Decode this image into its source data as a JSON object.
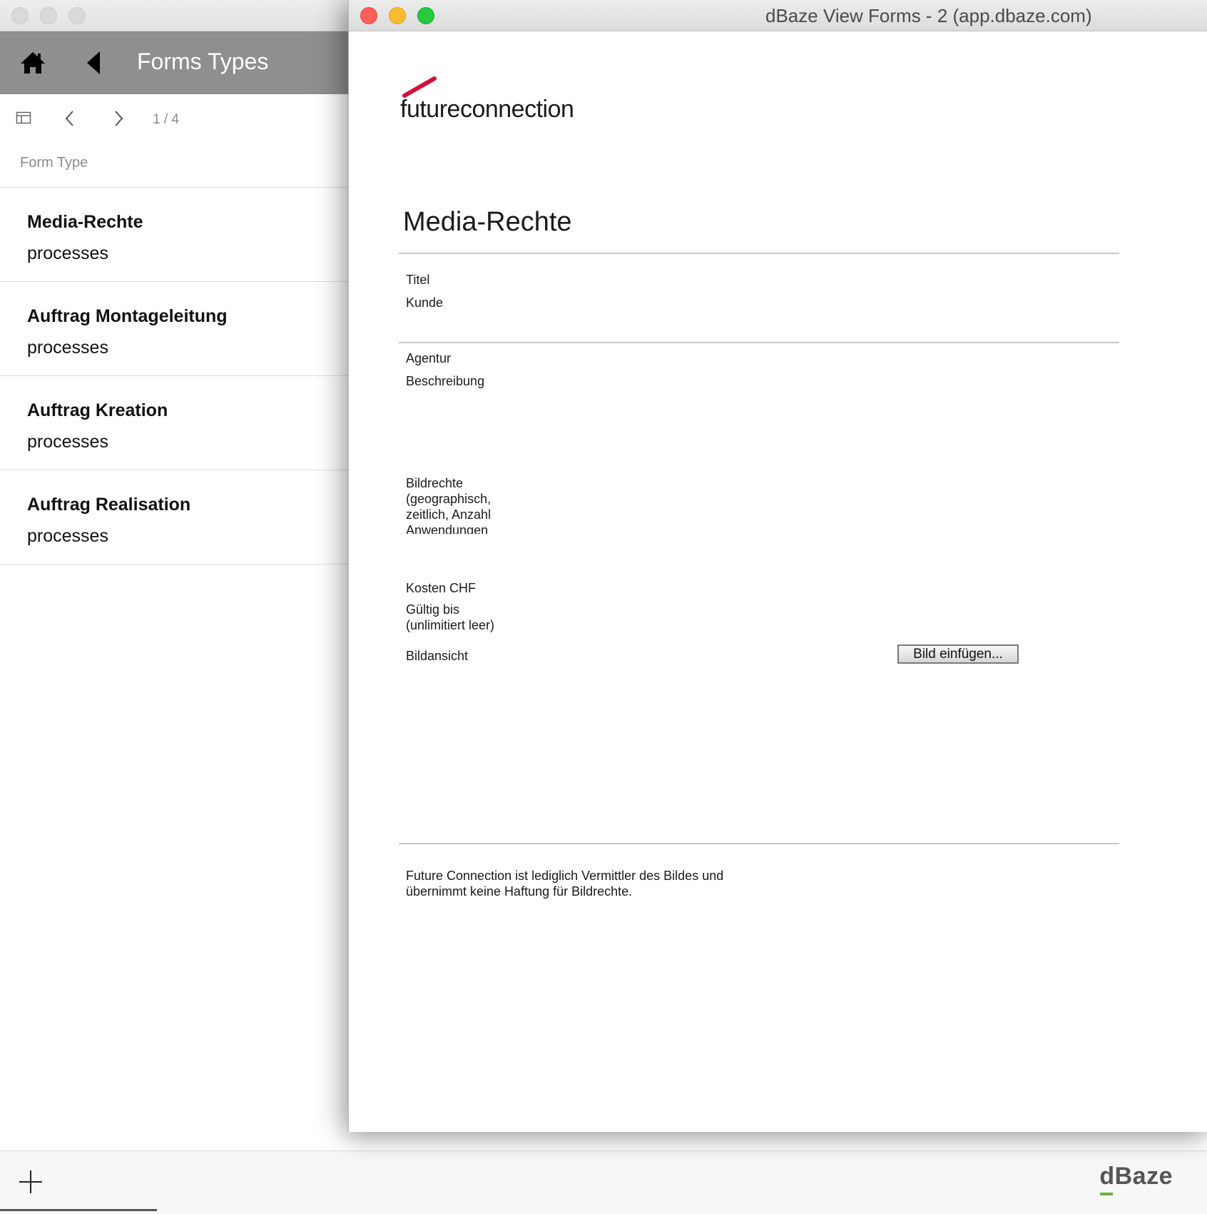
{
  "background_window": {
    "header": {
      "title": "Forms Types"
    },
    "pager": {
      "count": "1 / 4"
    },
    "list": {
      "column_header": "Form Type",
      "items": [
        {
          "title": "Media-Rechte",
          "subtitle": "processes"
        },
        {
          "title": "Auftrag Montageleitung",
          "subtitle": "processes"
        },
        {
          "title": "Auftrag Kreation",
          "subtitle": "processes"
        },
        {
          "title": "Auftrag Realisation",
          "subtitle": "processes"
        }
      ]
    },
    "footer": {
      "brand": "dBaze"
    }
  },
  "foreground_window": {
    "title": "dBaze View Forms - 2 (app.dbaze.com)",
    "logo_text": "futureconnection",
    "form": {
      "title": "Media-Rechte",
      "fields": {
        "titel": "Titel",
        "kunde": "Kunde",
        "agentur": "Agentur",
        "beschreibung": "Beschreibung",
        "bildrechte": [
          "Bildrechte",
          "(geographisch,",
          "zeitlich, Anzahl",
          "Anwendungen"
        ],
        "kosten": "Kosten CHF",
        "gueltig": [
          "Gültig bis",
          "(unlimitiert leer)"
        ],
        "bildansicht": "Bildansicht"
      },
      "insert_button": "Bild einfügen...",
      "disclaimer": [
        "Future Connection ist lediglich Vermittler des Bildes und",
        "übernimmt keine Haftung für Bildrechte."
      ]
    }
  },
  "colors": {
    "header_gray": "#8f8f8f",
    "logo_accent": "#d0103a",
    "brand_accent": "#6bb43f",
    "close": "#fe5f57",
    "minimize": "#febc2e",
    "zoom": "#28c840"
  },
  "icons": [
    "home-icon",
    "back-triangle-icon",
    "table-view-icon",
    "chevron-left-icon",
    "chevron-right-icon",
    "plus-icon"
  ]
}
